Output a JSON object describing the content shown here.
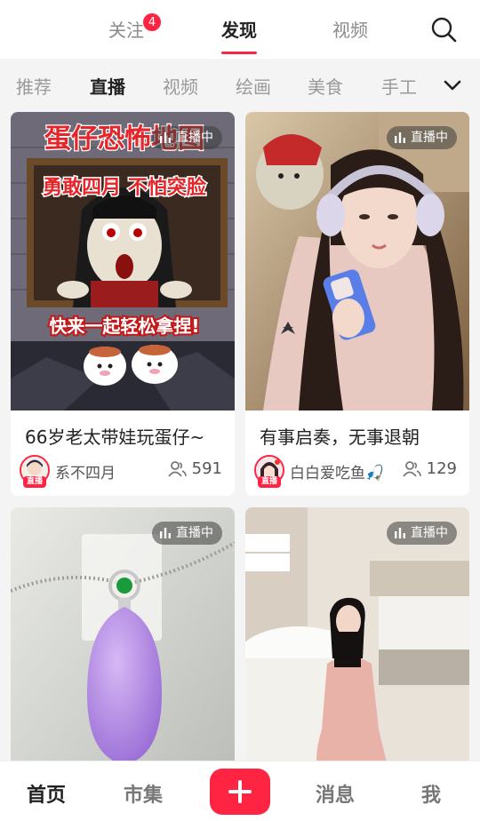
{
  "top_tabs": [
    {
      "label": "关注",
      "badge": "4"
    },
    {
      "label": "发现",
      "active": true
    },
    {
      "label": "视频"
    }
  ],
  "search": {
    "icon": "search-icon"
  },
  "categories": [
    "推荐",
    "直播",
    "视频",
    "绘画",
    "美食",
    "手工"
  ],
  "active_category": "直播",
  "category_more_icon": "chevron-down-icon",
  "live_label": "直播中",
  "avatar_tag": "直播",
  "feed": [
    {
      "title": "66岁老太带娃玩蛋仔~",
      "author": "系不四月",
      "viewers": "591",
      "poster": {
        "headline": "蛋仔恐怖地图",
        "line1": "勇敢四月 不怕突脸",
        "line2": "快来一起轻松拿捏!"
      }
    },
    {
      "title": "有事启奏，无事退朝",
      "author": "白白爱吃鱼🎣",
      "viewers": "129"
    },
    {
      "title": "",
      "author": "",
      "viewers": ""
    },
    {
      "title": "",
      "author": "",
      "viewers": ""
    }
  ],
  "bottom_nav": [
    "首页",
    "市集",
    "消息",
    "我"
  ],
  "colors": {
    "accent": "#ff2442",
    "text": "#222222",
    "muted": "#8a8a8a"
  }
}
